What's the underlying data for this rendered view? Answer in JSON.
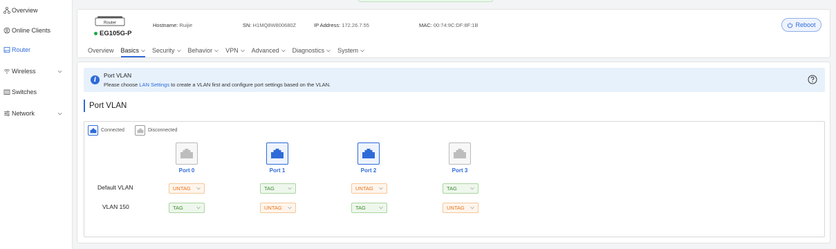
{
  "sidebar": {
    "items": [
      {
        "label": "Overview",
        "icon": "topology-icon"
      },
      {
        "label": "Online Clients",
        "icon": "clients-icon"
      },
      {
        "label": "Router",
        "icon": "router-icon"
      },
      {
        "label": "Wireless",
        "icon": "wireless-icon"
      },
      {
        "label": "Switches",
        "icon": "switch-icon"
      },
      {
        "label": "Network",
        "icon": "network-icon"
      }
    ],
    "active": "Router"
  },
  "device": {
    "tag": "Router",
    "model": "EG105G-P",
    "hostname_label": "Hostname:",
    "hostname": "Ruijie",
    "sn_label": "SN:",
    "sn": "H1MQ8W800680Z",
    "ip_label": "IP Address:",
    "ip": "172.26.7.55",
    "mac_label": "MAC:",
    "mac": "00:74:9C:DF:8F:1B",
    "reboot_label": "Reboot"
  },
  "tabs": [
    {
      "label": "Overview"
    },
    {
      "label": "Basics"
    },
    {
      "label": "Security"
    },
    {
      "label": "Behavior"
    },
    {
      "label": "VPN"
    },
    {
      "label": "Advanced"
    },
    {
      "label": "Diagnostics"
    },
    {
      "label": "System"
    }
  ],
  "notice": {
    "title": "Port VLAN",
    "text_before": "Please choose ",
    "link": "LAN Settings",
    "text_after": " to create a VLAN first and configure port settings based on the VLAN."
  },
  "section_title": "Port VLAN",
  "legend": {
    "connected": "Connected",
    "disconnected": "Disconnected"
  },
  "ports": [
    {
      "label": "Port 0",
      "connected": false
    },
    {
      "label": "Port 1",
      "connected": true
    },
    {
      "label": "Port 2",
      "connected": true
    },
    {
      "label": "Port 3",
      "connected": false
    }
  ],
  "vlans": [
    {
      "name": "Default VLAN",
      "modes": [
        "UNTAG",
        "TAG",
        "UNTAG",
        "TAG"
      ]
    },
    {
      "name": "VLAN 150",
      "modes": [
        "TAG",
        "UNTAG",
        "TAG",
        "UNTAG"
      ]
    }
  ],
  "colors": {
    "accent": "#2f6bd8",
    "untag": "#e8731a",
    "tag": "#3a8a2c",
    "online": "#1aa84a"
  }
}
